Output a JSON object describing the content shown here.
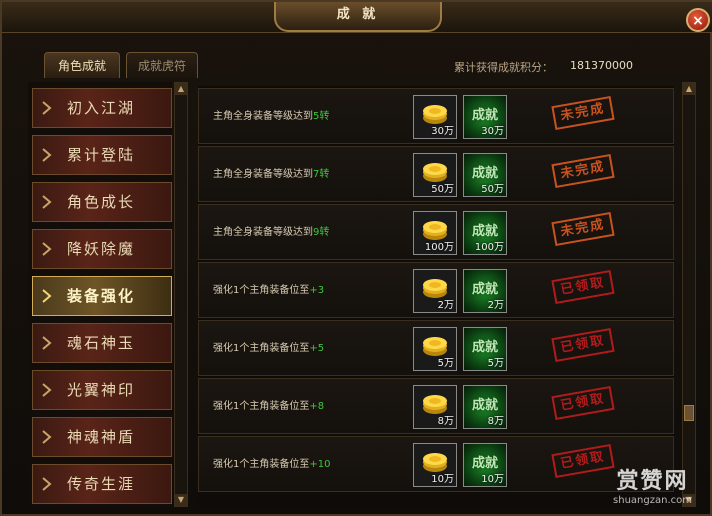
{
  "window": {
    "title": "成 就",
    "close_label": "×"
  },
  "tabs": [
    {
      "label": "角色成就",
      "active": true
    },
    {
      "label": "成就虎符",
      "active": false
    }
  ],
  "score": {
    "label": "累计获得成就积分：",
    "value": "181370000"
  },
  "sidebar": {
    "items": [
      {
        "label": "初入江湖",
        "active": false
      },
      {
        "label": "累计登陆",
        "active": false
      },
      {
        "label": "角色成长",
        "active": false
      },
      {
        "label": "降妖除魔",
        "active": false
      },
      {
        "label": "装备强化",
        "active": true
      },
      {
        "label": "魂石神玉",
        "active": false
      },
      {
        "label": "光翼神印",
        "active": false
      },
      {
        "label": "神魂神盾",
        "active": false
      },
      {
        "label": "传奇生涯",
        "active": false
      }
    ]
  },
  "achievements": [
    {
      "desc": "主角全身装备等级达到",
      "highlight": "5转",
      "coin": "30万",
      "achievement_icon": "成就",
      "achievement_points": "30万",
      "status": "未完成",
      "status_type": "incomplete"
    },
    {
      "desc": "主角全身装备等级达到",
      "highlight": "7转",
      "coin": "50万",
      "achievement_icon": "成就",
      "achievement_points": "50万",
      "status": "未完成",
      "status_type": "incomplete"
    },
    {
      "desc": "主角全身装备等级达到",
      "highlight": "9转",
      "coin": "100万",
      "achievement_icon": "成就",
      "achievement_points": "100万",
      "status": "未完成",
      "status_type": "incomplete"
    },
    {
      "desc": "强化1个主角装备位至",
      "highlight": "+3",
      "coin": "2万",
      "achievement_icon": "成就",
      "achievement_points": "2万",
      "status": "已领取",
      "status_type": "claimed"
    },
    {
      "desc": "强化1个主角装备位至",
      "highlight": "+5",
      "coin": "5万",
      "achievement_icon": "成就",
      "achievement_points": "5万",
      "status": "已领取",
      "status_type": "claimed"
    },
    {
      "desc": "强化1个主角装备位至",
      "highlight": "+8",
      "coin": "8万",
      "achievement_icon": "成就",
      "achievement_points": "8万",
      "status": "已领取",
      "status_type": "claimed"
    },
    {
      "desc": "强化1个主角装备位至",
      "highlight": "+10",
      "coin": "10万",
      "achievement_icon": "成就",
      "achievement_points": "10万",
      "status": "已领取",
      "status_type": "claimed"
    }
  ],
  "watermark": {
    "brand": "赏赞网",
    "url": "shuangzan.com"
  },
  "colors": {
    "highlight": "#3fc43f",
    "incomplete": "#c9531e",
    "claimed": "#b11b1b",
    "active_border": "#d4ac58"
  },
  "icons": {
    "coin": "gold-coin-stack-icon",
    "achievement": "green-achievement-icon",
    "chevron": "chevron-right-icon"
  }
}
